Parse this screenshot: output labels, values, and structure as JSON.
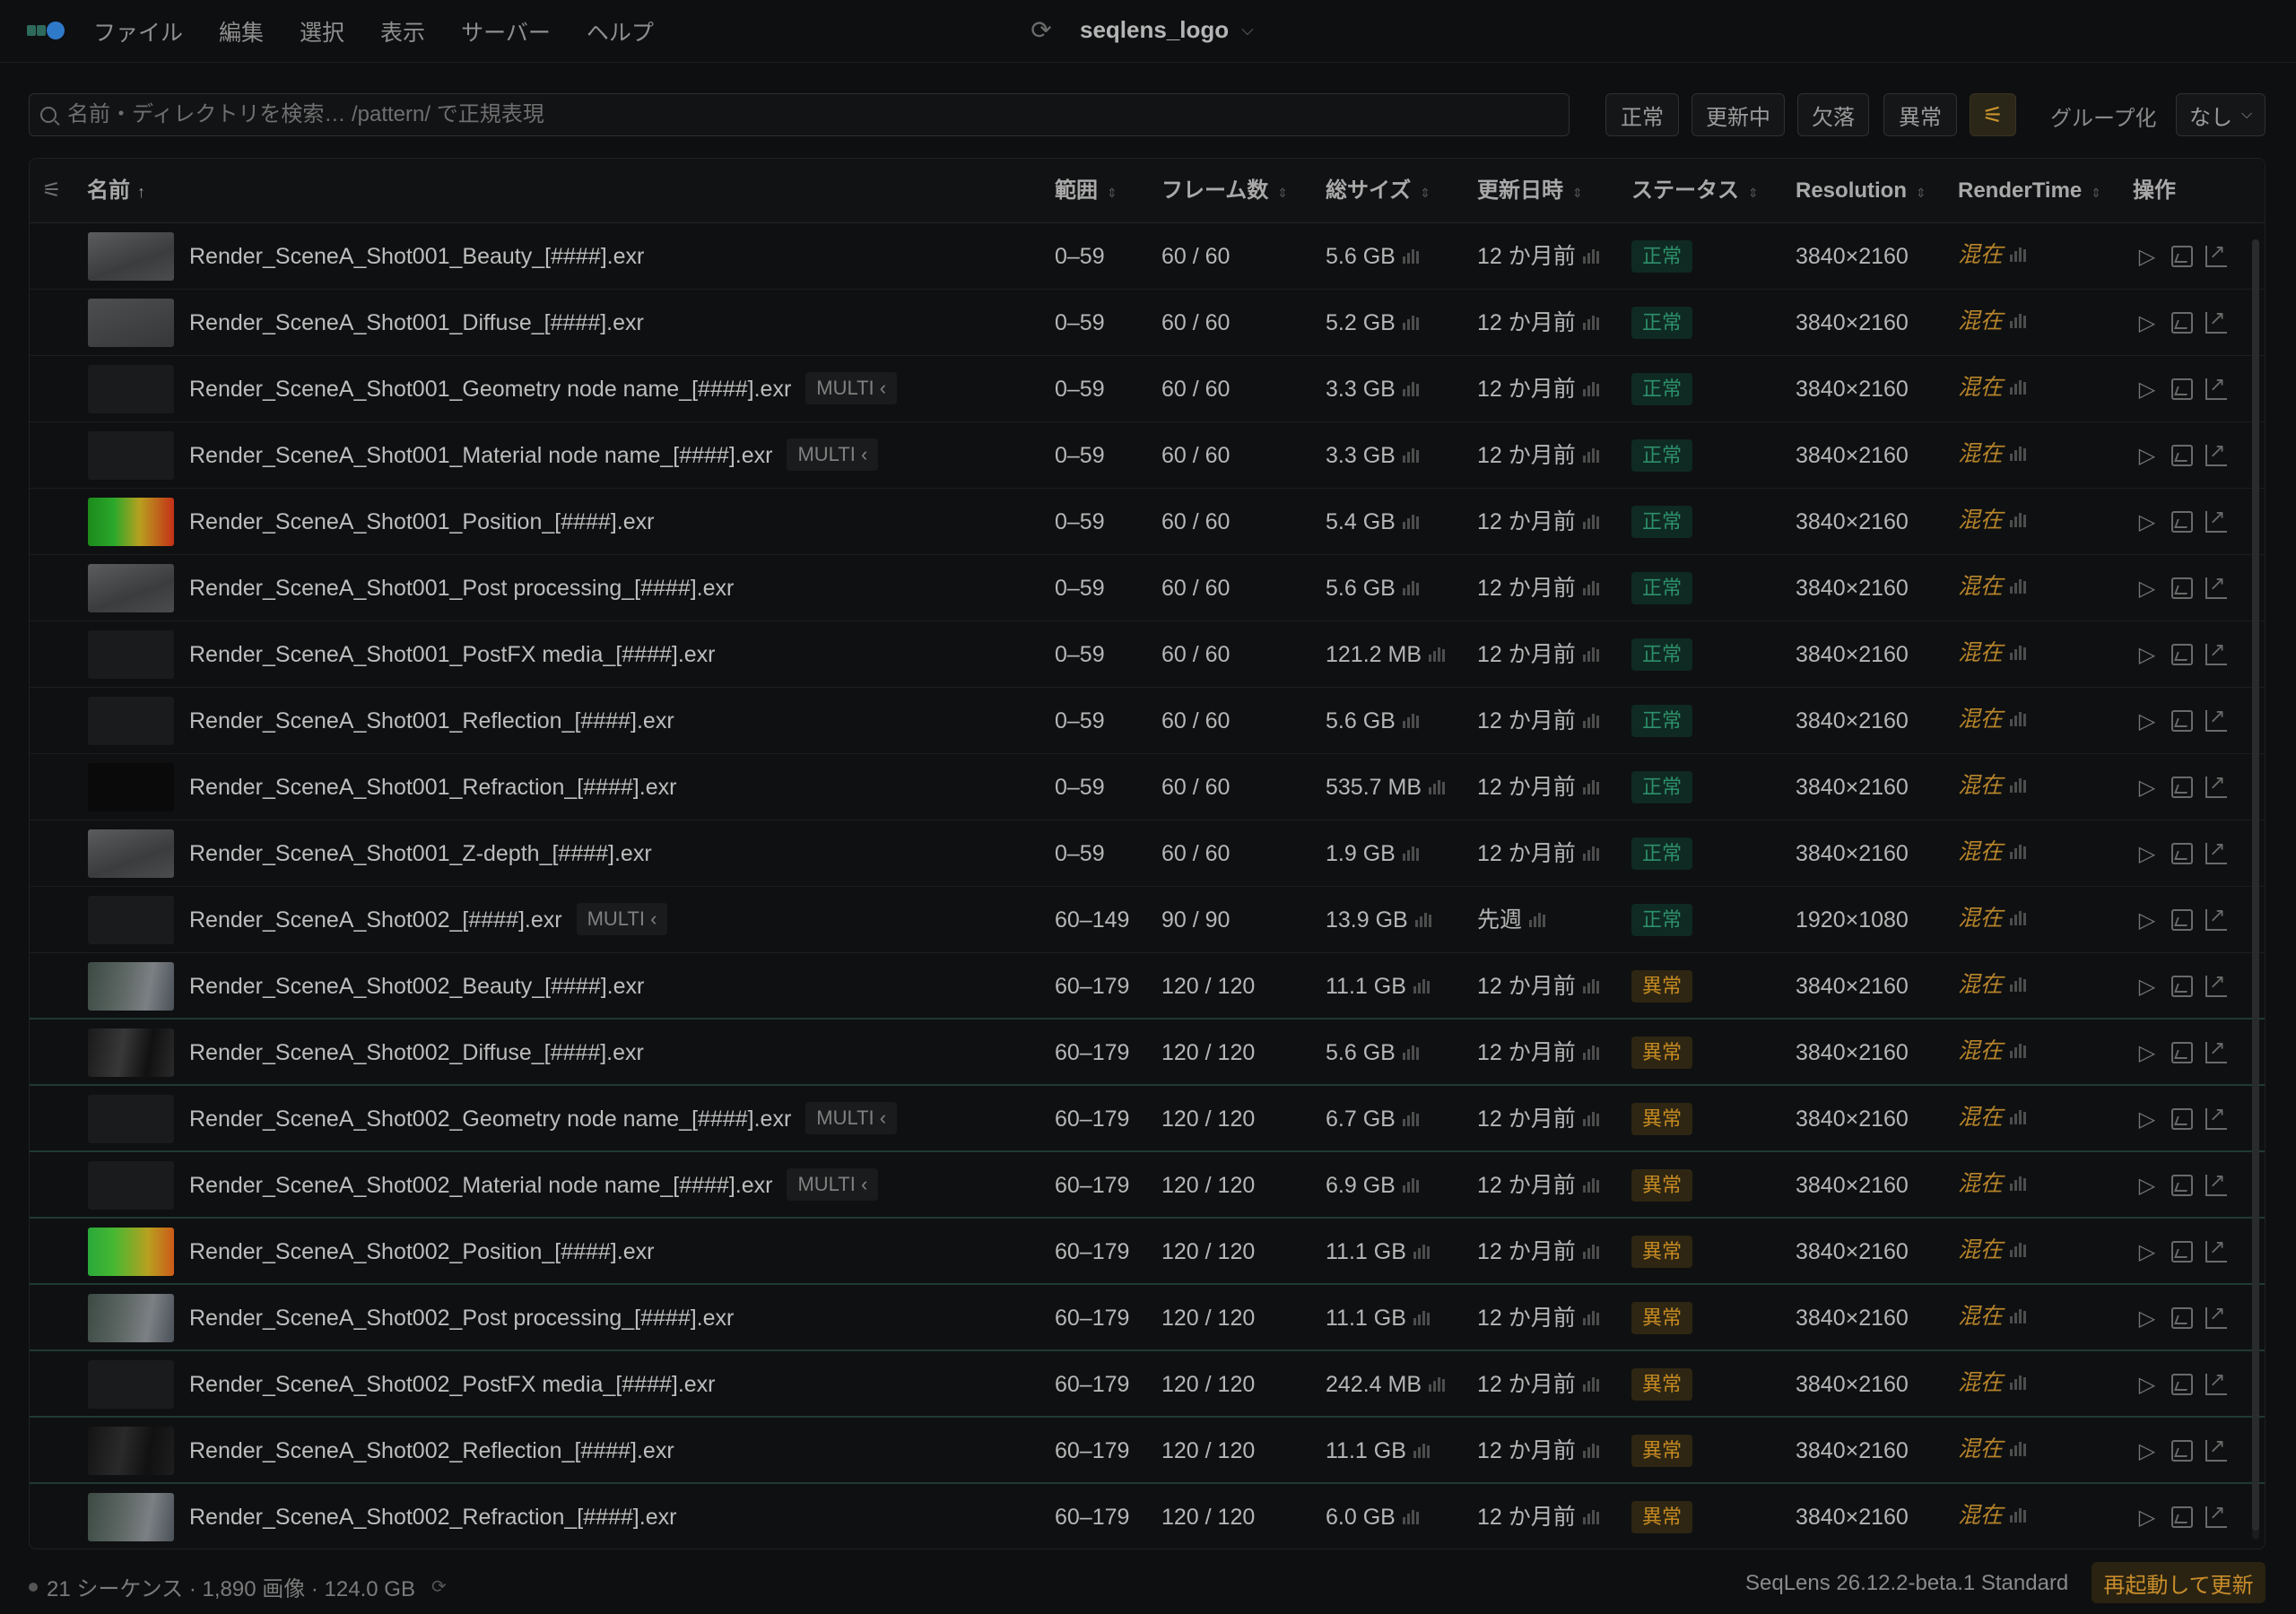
{
  "menubar": {
    "items": [
      "ファイル",
      "編集",
      "選択",
      "表示",
      "サーバー",
      "ヘルプ"
    ],
    "project_name": "seqlens_logo"
  },
  "toolbar": {
    "search_placeholder": "名前・ディレクトリを検索… /pattern/ で正規表現",
    "filters": [
      "正常",
      "更新中",
      "欠落",
      "異常"
    ],
    "group_label": "グループ化",
    "group_value": "なし"
  },
  "table": {
    "columns": {
      "name": "名前",
      "range": "範囲",
      "frames": "フレーム数",
      "size": "総サイズ",
      "modified": "更新日時",
      "status": "ステータス",
      "resolution": "Resolution",
      "rendertime": "RenderTime",
      "actions": "操作"
    },
    "multi_label": "MULTI",
    "rendertime_value": "混在",
    "rows": [
      {
        "name": "Render_SceneA_Shot001_Beauty_[####].exr",
        "multi": false,
        "range": "0–59",
        "frames": "60 / 60",
        "size": "5.6 GB",
        "modified": "12 か月前",
        "status": "正常",
        "resolution": "3840×2160",
        "thumb": "grey"
      },
      {
        "name": "Render_SceneA_Shot001_Diffuse_[####].exr",
        "multi": false,
        "range": "0–59",
        "frames": "60 / 60",
        "size": "5.2 GB",
        "modified": "12 か月前",
        "status": "正常",
        "resolution": "3840×2160",
        "thumb": "grey-dark"
      },
      {
        "name": "Render_SceneA_Shot001_Geometry node name_[####].exr",
        "multi": true,
        "range": "0–59",
        "frames": "60 / 60",
        "size": "3.3 GB",
        "modified": "12 か月前",
        "status": "正常",
        "resolution": "3840×2160",
        "thumb": "dark"
      },
      {
        "name": "Render_SceneA_Shot001_Material node name_[####].exr",
        "multi": true,
        "range": "0–59",
        "frames": "60 / 60",
        "size": "3.3 GB",
        "modified": "12 か月前",
        "status": "正常",
        "resolution": "3840×2160",
        "thumb": "dark"
      },
      {
        "name": "Render_SceneA_Shot001_Position_[####].exr",
        "multi": false,
        "range": "0–59",
        "frames": "60 / 60",
        "size": "5.4 GB",
        "modified": "12 か月前",
        "status": "正常",
        "resolution": "3840×2160",
        "thumb": "position"
      },
      {
        "name": "Render_SceneA_Shot001_Post processing_[####].exr",
        "multi": false,
        "range": "0–59",
        "frames": "60 / 60",
        "size": "5.6 GB",
        "modified": "12 か月前",
        "status": "正常",
        "resolution": "3840×2160",
        "thumb": "grey"
      },
      {
        "name": "Render_SceneA_Shot001_PostFX media_[####].exr",
        "multi": false,
        "range": "0–59",
        "frames": "60 / 60",
        "size": "121.2 MB",
        "modified": "12 か月前",
        "status": "正常",
        "resolution": "3840×2160",
        "thumb": "dark"
      },
      {
        "name": "Render_SceneA_Shot001_Reflection_[####].exr",
        "multi": false,
        "range": "0–59",
        "frames": "60 / 60",
        "size": "5.6 GB",
        "modified": "12 か月前",
        "status": "正常",
        "resolution": "3840×2160",
        "thumb": "dark"
      },
      {
        "name": "Render_SceneA_Shot001_Refraction_[####].exr",
        "multi": false,
        "range": "0–59",
        "frames": "60 / 60",
        "size": "535.7 MB",
        "modified": "12 か月前",
        "status": "正常",
        "resolution": "3840×2160",
        "thumb": "black"
      },
      {
        "name": "Render_SceneA_Shot001_Z-depth_[####].exr",
        "multi": false,
        "range": "0–59",
        "frames": "60 / 60",
        "size": "1.9 GB",
        "modified": "12 か月前",
        "status": "正常",
        "resolution": "3840×2160",
        "thumb": "grey"
      },
      {
        "name": "Render_SceneA_Shot002_[####].exr",
        "multi": true,
        "range": "60–149",
        "frames": "90 / 90",
        "size": "13.9 GB",
        "modified": "先週",
        "status": "正常",
        "resolution": "1920×1080",
        "thumb": "dark"
      },
      {
        "name": "Render_SceneA_Shot002_Beauty_[####].exr",
        "multi": false,
        "range": "60–179",
        "frames": "120 / 120",
        "size": "11.1 GB",
        "modified": "12 か月前",
        "status": "異常",
        "resolution": "3840×2160",
        "thumb": "scene"
      },
      {
        "name": "Render_SceneA_Shot002_Diffuse_[####].exr",
        "multi": false,
        "range": "60–179",
        "frames": "120 / 120",
        "size": "5.6 GB",
        "modified": "12 か月前",
        "status": "異常",
        "resolution": "3840×2160",
        "thumb": "diffuse"
      },
      {
        "name": "Render_SceneA_Shot002_Geometry node name_[####].exr",
        "multi": true,
        "range": "60–179",
        "frames": "120 / 120",
        "size": "6.7 GB",
        "modified": "12 か月前",
        "status": "異常",
        "resolution": "3840×2160",
        "thumb": "dark"
      },
      {
        "name": "Render_SceneA_Shot002_Material node name_[####].exr",
        "multi": true,
        "range": "60–179",
        "frames": "120 / 120",
        "size": "6.9 GB",
        "modified": "12 か月前",
        "status": "異常",
        "resolution": "3840×2160",
        "thumb": "dark"
      },
      {
        "name": "Render_SceneA_Shot002_Position_[####].exr",
        "multi": false,
        "range": "60–179",
        "frames": "120 / 120",
        "size": "11.1 GB",
        "modified": "12 か月前",
        "status": "異常",
        "resolution": "3840×2160",
        "thumb": "position2"
      },
      {
        "name": "Render_SceneA_Shot002_Post processing_[####].exr",
        "multi": false,
        "range": "60–179",
        "frames": "120 / 120",
        "size": "11.1 GB",
        "modified": "12 か月前",
        "status": "異常",
        "resolution": "3840×2160",
        "thumb": "scene"
      },
      {
        "name": "Render_SceneA_Shot002_PostFX media_[####].exr",
        "multi": false,
        "range": "60–179",
        "frames": "120 / 120",
        "size": "242.4 MB",
        "modified": "12 か月前",
        "status": "異常",
        "resolution": "3840×2160",
        "thumb": "dark"
      },
      {
        "name": "Render_SceneA_Shot002_Reflection_[####].exr",
        "multi": false,
        "range": "60–179",
        "frames": "120 / 120",
        "size": "11.1 GB",
        "modified": "12 か月前",
        "status": "異常",
        "resolution": "3840×2160",
        "thumb": "reflect"
      },
      {
        "name": "Render_SceneA_Shot002_Refraction_[####].exr",
        "multi": false,
        "range": "60–179",
        "frames": "120 / 120",
        "size": "6.0 GB",
        "modified": "12 か月前",
        "status": "異常",
        "resolution": "3840×2160",
        "thumb": "scene"
      }
    ]
  },
  "footer": {
    "summary": "21 シーケンス · 1,890 画像 · 124.0 GB",
    "version": "SeqLens 26.12.2-beta.1 Standard",
    "update_button": "再起動して更新"
  },
  "colors": {
    "ok": "#2e8f6b",
    "error": "#c58a22",
    "accent": "#c8942d"
  }
}
